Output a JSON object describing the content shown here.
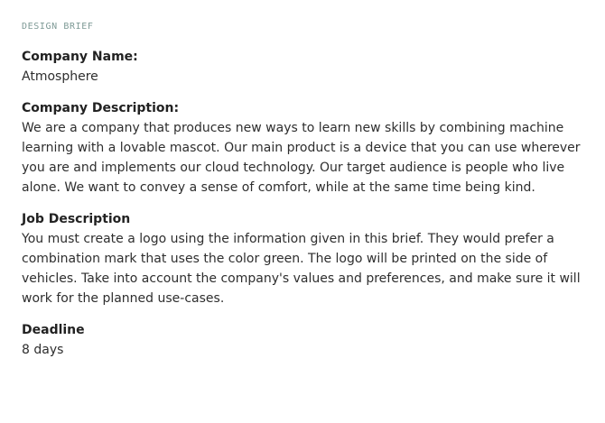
{
  "brief": {
    "eyebrow": "DESIGN BRIEF",
    "sections": [
      {
        "heading": "Company Name:",
        "body": "Atmosphere"
      },
      {
        "heading": "Company Description:",
        "body": "We are a company that produces new ways to learn new skills by combining machine learning with a lovable mascot. Our main product is a device that you can use wherever you are and implements our cloud technology. Our target audience is people who live alone. We want to convey a sense of comfort, while at the same time being kind."
      },
      {
        "heading": "Job Description",
        "body": "You must create a logo using the information given in this brief. They would prefer a combination mark that uses the color green. The logo will be printed on the side of vehicles. Take into account the company's values and preferences, and make sure it will work for the planned use-cases."
      },
      {
        "heading": "Deadline",
        "body": "8 days"
      }
    ]
  }
}
